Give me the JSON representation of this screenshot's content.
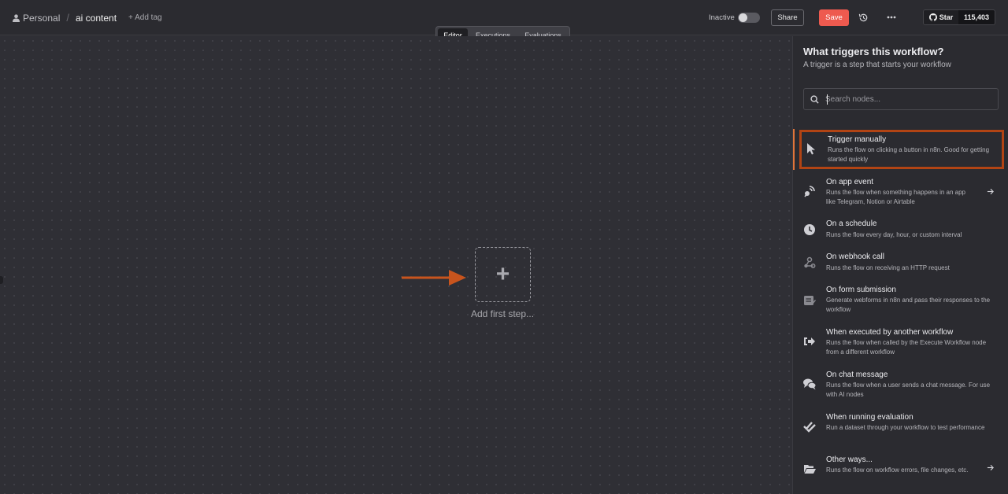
{
  "header": {
    "personal": "Personal",
    "workflow_name": "ai content",
    "add_tag": "+ Add tag",
    "inactive": "Inactive",
    "share": "Share",
    "save": "Save",
    "star": "Star",
    "star_count": "115,403"
  },
  "tabs": [
    "Editor",
    "Executions",
    "Evaluations"
  ],
  "canvas": {
    "add_first_step": "Add first step..."
  },
  "panel": {
    "title": "What triggers this workflow?",
    "subtitle": "A trigger is a step that starts your workflow",
    "search_placeholder": "Search nodes...",
    "items": [
      {
        "title": "Trigger manually",
        "desc": "Runs the flow on clicking a button in n8n. Good for getting started quickly",
        "icon": "cursor-icon"
      },
      {
        "title": "On app event",
        "desc": "Runs the flow when something happens in an app like Telegram, Notion or Airtable",
        "icon": "satellite-icon"
      },
      {
        "title": "On a schedule",
        "desc": "Runs the flow every day, hour, or custom interval",
        "icon": "clock-icon"
      },
      {
        "title": "On webhook call",
        "desc": "Runs the flow on receiving an HTTP request",
        "icon": "webhook-icon"
      },
      {
        "title": "On form submission",
        "desc": "Generate webforms in n8n and pass their responses to the workflow",
        "icon": "form-icon"
      },
      {
        "title": "When executed by another workflow",
        "desc": "Runs the flow when called by the Execute Workflow node from a different workflow",
        "icon": "sign-in-icon"
      },
      {
        "title": "On chat message",
        "desc": "Runs the flow when a user sends a chat message. For use with AI nodes",
        "icon": "comments-icon"
      },
      {
        "title": "When running evaluation",
        "desc": "Run a dataset through your workflow to test performance",
        "icon": "check-double-icon"
      },
      {
        "title": "Other ways...",
        "desc": "Runs the flow on workflow errors, file changes, etc.",
        "icon": "folder-open-icon"
      }
    ]
  },
  "colors": {
    "accent_save": "#ee5a4f",
    "highlight": "#b24414",
    "arrow": "#c8541d"
  }
}
